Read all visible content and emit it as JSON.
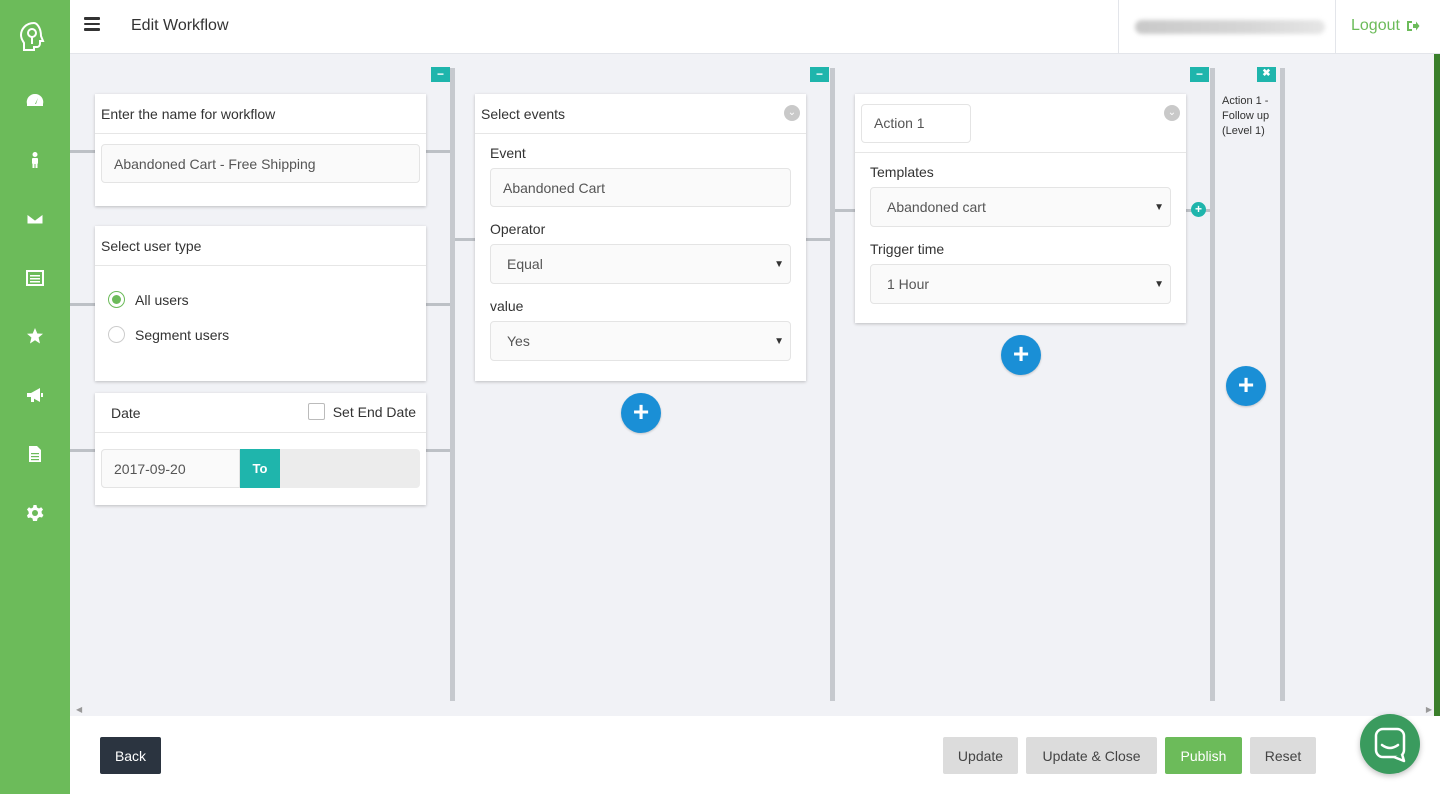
{
  "header": {
    "title": "Edit Workflow",
    "logout_label": "Logout"
  },
  "sidebar": {
    "items": [
      {
        "icon": "dashboard-icon"
      },
      {
        "icon": "user-icon"
      },
      {
        "icon": "envelope-icon"
      },
      {
        "icon": "list-icon"
      },
      {
        "icon": "star-icon"
      },
      {
        "icon": "megaphone-icon"
      },
      {
        "icon": "document-icon"
      },
      {
        "icon": "gear-icon"
      }
    ]
  },
  "workflow": {
    "name_card": {
      "title": "Enter the name for workflow",
      "value": "Abandoned Cart - Free Shipping"
    },
    "user_type_card": {
      "title": "Select user type",
      "options": [
        "All users",
        "Segment users"
      ],
      "selected": "All users"
    },
    "date_card": {
      "title": "Date",
      "end_date_label": "Set End Date",
      "start_date": "2017-09-20",
      "to_label": "To"
    },
    "events_card": {
      "title": "Select events",
      "event_label": "Event",
      "event_value": "Abandoned Cart",
      "operator_label": "Operator",
      "operator_value": "Equal",
      "value_label": "value",
      "value_value": "Yes"
    },
    "action_card": {
      "name": "Action 1",
      "templates_label": "Templates",
      "templates_value": "Abandoned cart",
      "trigger_label": "Trigger time",
      "trigger_value": "1 Hour"
    },
    "followup_label": "Action 1 - Follow up (Level 1)"
  },
  "footer": {
    "back_label": "Back",
    "update_label": "Update",
    "update_close_label": "Update & Close",
    "publish_label": "Publish",
    "reset_label": "Reset"
  },
  "colors": {
    "brand_green": "#6cbb5a",
    "teal": "#1fb5ac",
    "blue": "#1a8fd6",
    "dark": "#2b3440"
  }
}
